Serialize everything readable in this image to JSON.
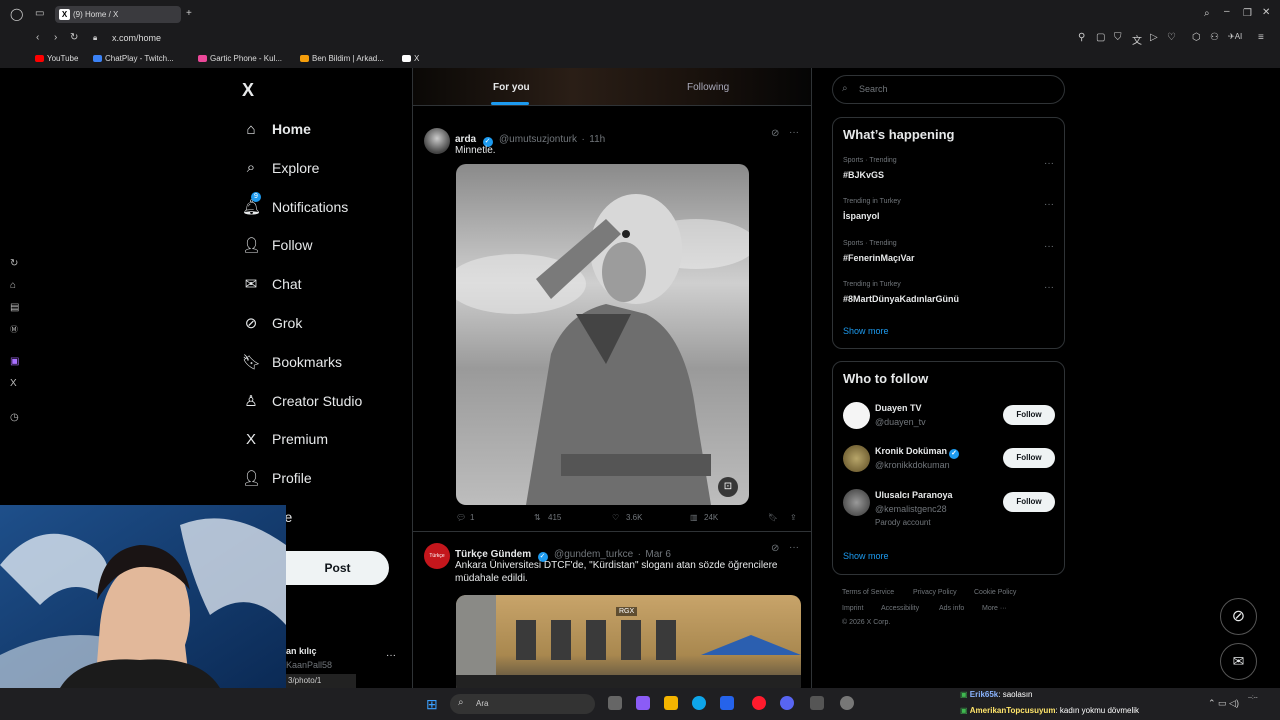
{
  "browser": {
    "tab_title": "(9) Home / X",
    "tab_favicon": "X",
    "url": "x.com/home",
    "bookmarks": [
      {
        "label": "YouTube",
        "color": "#ff0000"
      },
      {
        "label": "ChatPlay - Twitch...",
        "color": "#3b82f6"
      },
      {
        "label": "Gartic Phone - Kul...",
        "color": "#ec4899"
      },
      {
        "label": "Ben Bildim | Arkad...",
        "color": "#f59e0b"
      },
      {
        "label": "X",
        "color": "#ffffff"
      }
    ]
  },
  "nav": {
    "logo": "X",
    "items": [
      {
        "label": "Home",
        "icon": "home-icon",
        "glyph": "⌂"
      },
      {
        "label": "Explore",
        "icon": "search-icon",
        "glyph": "⌕"
      },
      {
        "label": "Notifications",
        "icon": "bell-icon",
        "glyph": "🔔︎",
        "badge": "9"
      },
      {
        "label": "Follow",
        "icon": "add-user-icon",
        "glyph": "👤︎"
      },
      {
        "label": "Chat",
        "icon": "mail-icon",
        "glyph": "✉"
      },
      {
        "label": "Grok",
        "icon": "grok-icon",
        "glyph": "⊘"
      },
      {
        "label": "Bookmarks",
        "icon": "bookmark-icon",
        "glyph": "🔖︎"
      },
      {
        "label": "Creator Studio",
        "icon": "creator-studio-icon",
        "glyph": "♙"
      },
      {
        "label": "Premium",
        "icon": "x-premium-icon",
        "glyph": "X"
      },
      {
        "label": "Profile",
        "icon": "profile-icon",
        "glyph": "👤︎"
      },
      {
        "label": "ore",
        "icon": "more-icon",
        "glyph": ""
      }
    ],
    "post_label": "Post",
    "account_name": "an kılıç",
    "account_handle": "KaanPall58",
    "status_url": "3/photo/1"
  },
  "feed": {
    "tabs": [
      "For you",
      "Following"
    ],
    "tweets": [
      {
        "name": "arda",
        "handle": "@umutsuzjonturk",
        "time": "11h",
        "text": "Minnetle.",
        "replies": "1",
        "reposts": "415",
        "likes": "3.6K",
        "views": "24K"
      },
      {
        "name": "Türkçe Gündem",
        "handle": "@gundem_turkce",
        "time": "Mar 6",
        "text": "Ankara Üniversitesi DTCF'de, \"Kürdistan\" sloganı atan sözde öğrencilere müdahale edildi.",
        "watermark": "RGX"
      }
    ]
  },
  "sidebar": {
    "search_placeholder": "Search",
    "happening_title": "What’s happening",
    "trends": [
      {
        "meta": "Sports · Trending",
        "name": "#BJKvGS"
      },
      {
        "meta": "Trending in Turkey",
        "name": "İspanyol"
      },
      {
        "meta": "Sports · Trending",
        "name": "#FenerinMaçıVar"
      },
      {
        "meta": "Trending in Turkey",
        "name": "#8MartDünyaKadınlarGünü"
      }
    ],
    "show_more": "Show more",
    "follow_title": "Who to follow",
    "suggestions": [
      {
        "name": "Duayen TV",
        "handle": "@duayen_tv",
        "verified": false
      },
      {
        "name": "Kronik Doküman",
        "handle": "@kronikkdokuman",
        "verified": true
      },
      {
        "name": "Ulusalcı Paranoya",
        "handle": "@kemalistgenc28",
        "verified": false,
        "note": "Parody account"
      }
    ],
    "follow_label": "Follow",
    "footer": [
      "Terms of Service",
      "Privacy Policy",
      "Cookie Policy",
      "Imprint",
      "Accessibility",
      "Ads info",
      "More ···",
      "© 2026 X Corp."
    ]
  },
  "taskbar": {
    "search_placeholder": "Ara",
    "chat": [
      {
        "user": "Erik65k",
        "message": ": saolasın"
      },
      {
        "user": "AmerikanTopcusuyum",
        "message": ": kadın yokmu dövmelik"
      }
    ]
  },
  "colors": {
    "accent": "#1d9bf0",
    "background": "#000000",
    "border": "#2f3336"
  }
}
